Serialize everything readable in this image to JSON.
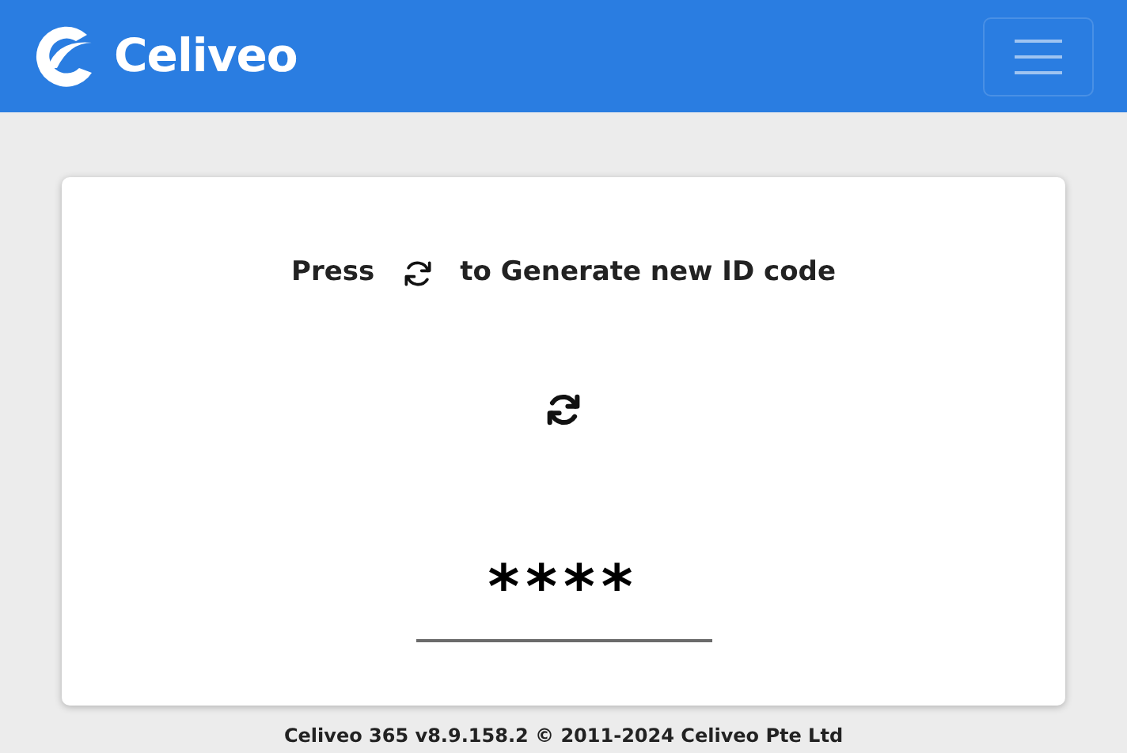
{
  "navbar": {
    "brand": "Celiveo"
  },
  "card": {
    "instruction_before": "Press",
    "instruction_after": "to Generate new ID code",
    "code": "****"
  },
  "footer": "Celiveo 365 v8.9.158.2 © 2011-2024 Celiveo Pte Ltd"
}
